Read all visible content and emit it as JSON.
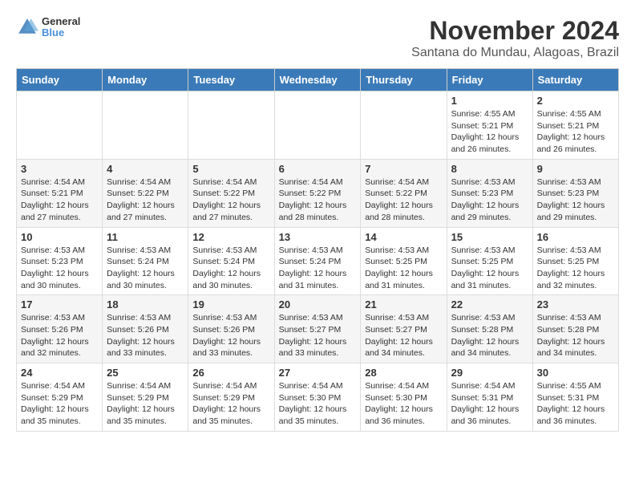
{
  "header": {
    "logo": {
      "line1": "General",
      "line2": "Blue"
    },
    "title": "November 2024",
    "location": "Santana do Mundau, Alagoas, Brazil"
  },
  "weekdays": [
    "Sunday",
    "Monday",
    "Tuesday",
    "Wednesday",
    "Thursday",
    "Friday",
    "Saturday"
  ],
  "weeks": [
    [
      {
        "day": "",
        "detail": ""
      },
      {
        "day": "",
        "detail": ""
      },
      {
        "day": "",
        "detail": ""
      },
      {
        "day": "",
        "detail": ""
      },
      {
        "day": "",
        "detail": ""
      },
      {
        "day": "1",
        "detail": "Sunrise: 4:55 AM\nSunset: 5:21 PM\nDaylight: 12 hours and 26 minutes."
      },
      {
        "day": "2",
        "detail": "Sunrise: 4:55 AM\nSunset: 5:21 PM\nDaylight: 12 hours and 26 minutes."
      }
    ],
    [
      {
        "day": "3",
        "detail": "Sunrise: 4:54 AM\nSunset: 5:21 PM\nDaylight: 12 hours and 27 minutes."
      },
      {
        "day": "4",
        "detail": "Sunrise: 4:54 AM\nSunset: 5:22 PM\nDaylight: 12 hours and 27 minutes."
      },
      {
        "day": "5",
        "detail": "Sunrise: 4:54 AM\nSunset: 5:22 PM\nDaylight: 12 hours and 27 minutes."
      },
      {
        "day": "6",
        "detail": "Sunrise: 4:54 AM\nSunset: 5:22 PM\nDaylight: 12 hours and 28 minutes."
      },
      {
        "day": "7",
        "detail": "Sunrise: 4:54 AM\nSunset: 5:22 PM\nDaylight: 12 hours and 28 minutes."
      },
      {
        "day": "8",
        "detail": "Sunrise: 4:53 AM\nSunset: 5:23 PM\nDaylight: 12 hours and 29 minutes."
      },
      {
        "day": "9",
        "detail": "Sunrise: 4:53 AM\nSunset: 5:23 PM\nDaylight: 12 hours and 29 minutes."
      }
    ],
    [
      {
        "day": "10",
        "detail": "Sunrise: 4:53 AM\nSunset: 5:23 PM\nDaylight: 12 hours and 30 minutes."
      },
      {
        "day": "11",
        "detail": "Sunrise: 4:53 AM\nSunset: 5:24 PM\nDaylight: 12 hours and 30 minutes."
      },
      {
        "day": "12",
        "detail": "Sunrise: 4:53 AM\nSunset: 5:24 PM\nDaylight: 12 hours and 30 minutes."
      },
      {
        "day": "13",
        "detail": "Sunrise: 4:53 AM\nSunset: 5:24 PM\nDaylight: 12 hours and 31 minutes."
      },
      {
        "day": "14",
        "detail": "Sunrise: 4:53 AM\nSunset: 5:25 PM\nDaylight: 12 hours and 31 minutes."
      },
      {
        "day": "15",
        "detail": "Sunrise: 4:53 AM\nSunset: 5:25 PM\nDaylight: 12 hours and 31 minutes."
      },
      {
        "day": "16",
        "detail": "Sunrise: 4:53 AM\nSunset: 5:25 PM\nDaylight: 12 hours and 32 minutes."
      }
    ],
    [
      {
        "day": "17",
        "detail": "Sunrise: 4:53 AM\nSunset: 5:26 PM\nDaylight: 12 hours and 32 minutes."
      },
      {
        "day": "18",
        "detail": "Sunrise: 4:53 AM\nSunset: 5:26 PM\nDaylight: 12 hours and 33 minutes."
      },
      {
        "day": "19",
        "detail": "Sunrise: 4:53 AM\nSunset: 5:26 PM\nDaylight: 12 hours and 33 minutes."
      },
      {
        "day": "20",
        "detail": "Sunrise: 4:53 AM\nSunset: 5:27 PM\nDaylight: 12 hours and 33 minutes."
      },
      {
        "day": "21",
        "detail": "Sunrise: 4:53 AM\nSunset: 5:27 PM\nDaylight: 12 hours and 34 minutes."
      },
      {
        "day": "22",
        "detail": "Sunrise: 4:53 AM\nSunset: 5:28 PM\nDaylight: 12 hours and 34 minutes."
      },
      {
        "day": "23",
        "detail": "Sunrise: 4:53 AM\nSunset: 5:28 PM\nDaylight: 12 hours and 34 minutes."
      }
    ],
    [
      {
        "day": "24",
        "detail": "Sunrise: 4:54 AM\nSunset: 5:29 PM\nDaylight: 12 hours and 35 minutes."
      },
      {
        "day": "25",
        "detail": "Sunrise: 4:54 AM\nSunset: 5:29 PM\nDaylight: 12 hours and 35 minutes."
      },
      {
        "day": "26",
        "detail": "Sunrise: 4:54 AM\nSunset: 5:29 PM\nDaylight: 12 hours and 35 minutes."
      },
      {
        "day": "27",
        "detail": "Sunrise: 4:54 AM\nSunset: 5:30 PM\nDaylight: 12 hours and 35 minutes."
      },
      {
        "day": "28",
        "detail": "Sunrise: 4:54 AM\nSunset: 5:30 PM\nDaylight: 12 hours and 36 minutes."
      },
      {
        "day": "29",
        "detail": "Sunrise: 4:54 AM\nSunset: 5:31 PM\nDaylight: 12 hours and 36 minutes."
      },
      {
        "day": "30",
        "detail": "Sunrise: 4:55 AM\nSunset: 5:31 PM\nDaylight: 12 hours and 36 minutes."
      }
    ]
  ]
}
